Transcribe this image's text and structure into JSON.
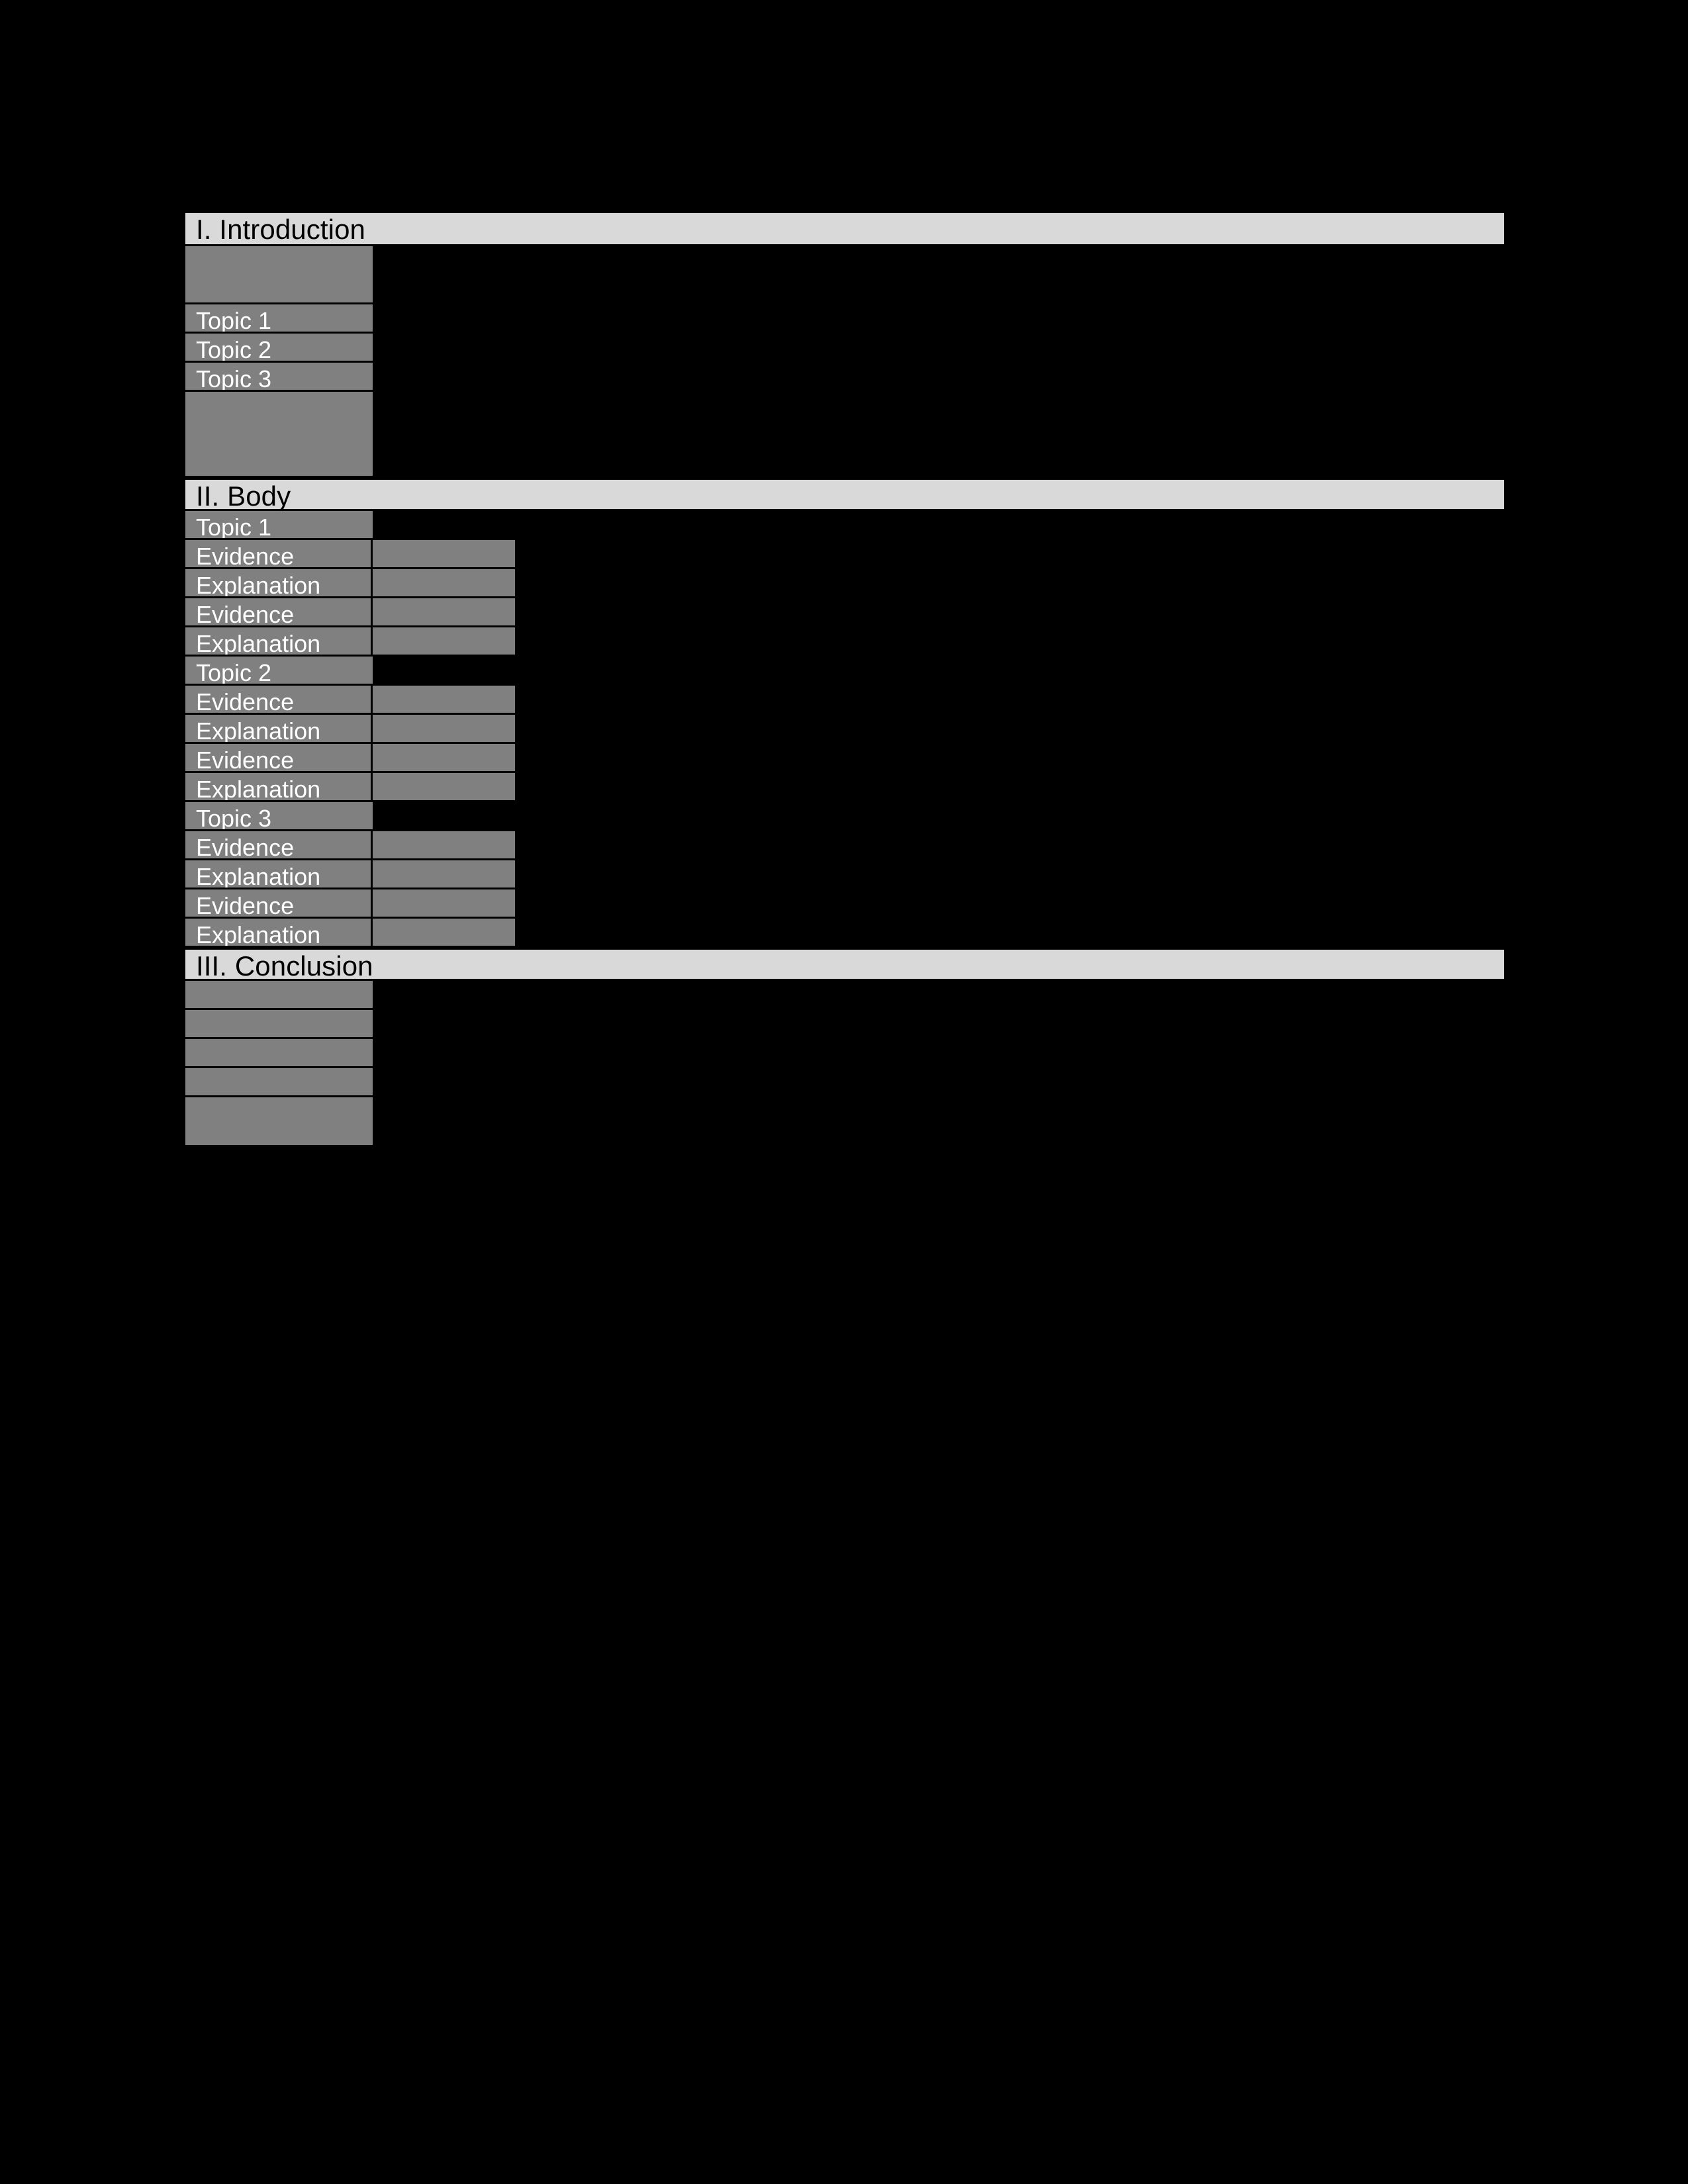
{
  "document": {
    "type": "essay-outline-template",
    "colors": {
      "page_background": "#000000",
      "section_header_fill": "#D9D9D9",
      "section_header_text": "#000000",
      "cell_fill": "#808080",
      "cell_text": "#FFFFFF",
      "border": "#000000"
    }
  },
  "sections": [
    {
      "id": "introduction",
      "heading": "I. Introduction",
      "rows": [
        {
          "name": "intro-blank-top",
          "label": "",
          "height": 88,
          "columns": 1
        },
        {
          "name": "intro-topic-1",
          "label": "Topic 1",
          "height": 44,
          "columns": 1
        },
        {
          "name": "intro-topic-2",
          "label": "Topic 2",
          "height": 44,
          "columns": 1
        },
        {
          "name": "intro-topic-3",
          "label": "Topic 3",
          "height": 44,
          "columns": 1
        },
        {
          "name": "intro-blank-bottom",
          "label": "",
          "height": 130,
          "columns": 1
        }
      ]
    },
    {
      "id": "body",
      "heading": "II. Body",
      "rows": [
        {
          "name": "body-topic-1",
          "label": "Topic 1",
          "height": 44,
          "columns": 1
        },
        {
          "name": "body-evidence-1a",
          "label": "Evidence",
          "height": 44,
          "columns": 2
        },
        {
          "name": "body-explanation-1a",
          "label": "Explanation",
          "height": 44,
          "columns": 2
        },
        {
          "name": "body-evidence-1b",
          "label": "Evidence",
          "height": 44,
          "columns": 2
        },
        {
          "name": "body-explanation-1b",
          "label": "Explanation",
          "height": 44,
          "columns": 2
        },
        {
          "name": "body-topic-2",
          "label": "Topic 2",
          "height": 44,
          "columns": 1
        },
        {
          "name": "body-evidence-2a",
          "label": "Evidence",
          "height": 44,
          "columns": 2
        },
        {
          "name": "body-explanation-2a",
          "label": "Explanation",
          "height": 44,
          "columns": 2
        },
        {
          "name": "body-evidence-2b",
          "label": "Evidence",
          "height": 44,
          "columns": 2
        },
        {
          "name": "body-explanation-2b",
          "label": "Explanation",
          "height": 44,
          "columns": 2
        },
        {
          "name": "body-topic-3",
          "label": "Topic 3",
          "height": 44,
          "columns": 1
        },
        {
          "name": "body-evidence-3a",
          "label": "Evidence",
          "height": 44,
          "columns": 2
        },
        {
          "name": "body-explanation-3a",
          "label": "Explanation",
          "height": 44,
          "columns": 2
        },
        {
          "name": "body-evidence-3b",
          "label": "Evidence",
          "height": 44,
          "columns": 2
        },
        {
          "name": "body-explanation-3b",
          "label": "Explanation",
          "height": 44,
          "columns": 2
        }
      ]
    },
    {
      "id": "conclusion",
      "heading": "III. Conclusion",
      "rows": [
        {
          "name": "conclusion-blank-1",
          "label": "",
          "height": 44,
          "columns": 1
        },
        {
          "name": "conclusion-blank-2",
          "label": "",
          "height": 44,
          "columns": 1
        },
        {
          "name": "conclusion-blank-3",
          "label": "",
          "height": 44,
          "columns": 1
        },
        {
          "name": "conclusion-blank-4",
          "label": "",
          "height": 44,
          "columns": 1
        },
        {
          "name": "conclusion-blank-5",
          "label": "",
          "height": 75,
          "columns": 1
        }
      ]
    }
  ]
}
